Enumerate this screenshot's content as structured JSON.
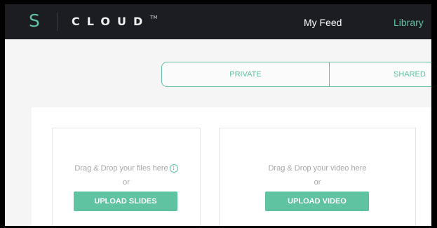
{
  "header": {
    "logo_letter": "S",
    "brand": "CLOUD",
    "trademark": "TM",
    "nav": {
      "feed": "My Feed",
      "library": "Library"
    }
  },
  "tabs": {
    "private": "PRIVATE",
    "shared": "SHARED"
  },
  "upload": {
    "slides": {
      "hint": "Drag & Drop your files here",
      "or": "or",
      "button": "UPLOAD SLIDES"
    },
    "video": {
      "hint": "Drag & Drop your video here",
      "or": "or",
      "button": "UPLOAD VIDEO"
    }
  },
  "icons": {
    "info": "info-icon"
  },
  "colors": {
    "accent": "#5fc2a0",
    "topbar": "#1b1d23",
    "background": "#f5f5f5"
  }
}
